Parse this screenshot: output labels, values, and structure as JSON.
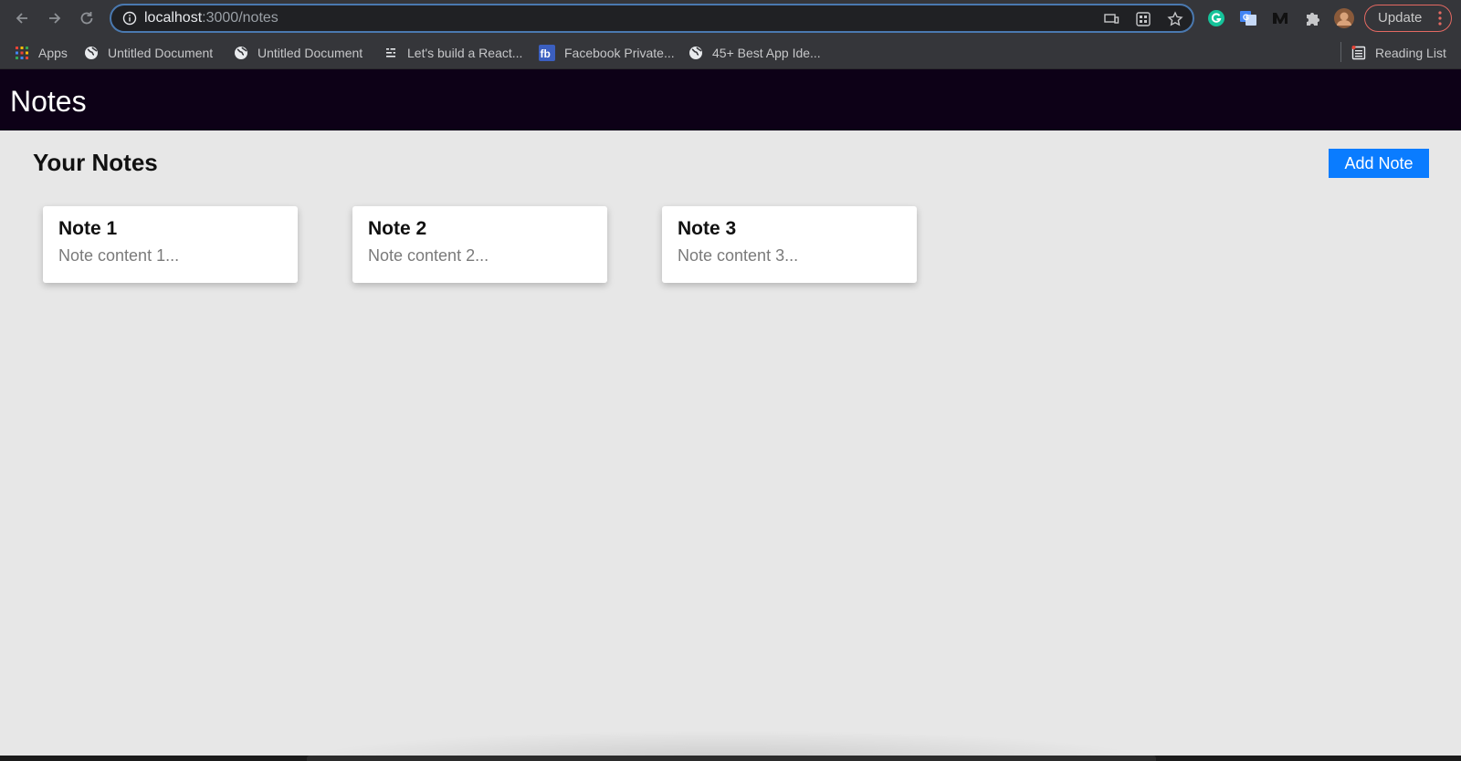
{
  "browser": {
    "url_host": "localhost",
    "url_path": ":3000/notes",
    "update_label": "Update",
    "bookmarks": [
      {
        "label": "Apps",
        "icon": "apps-grid-icon"
      },
      {
        "label": "Untitled Document",
        "icon": "globe-icon"
      },
      {
        "label": "Untitled Document",
        "icon": "globe-icon"
      },
      {
        "label": "Let's build a React...",
        "icon": "list-icon"
      },
      {
        "label": "Facebook Private...",
        "icon": "fb-icon"
      },
      {
        "label": "45+ Best App Ide...",
        "icon": "globe-icon"
      }
    ],
    "reading_list": "Reading List",
    "fb_glyph": "fb"
  },
  "app": {
    "title": "Notes",
    "heading": "Your Notes",
    "add_label": "Add Note",
    "notes": [
      {
        "title": "Note 1",
        "content": "Note content 1..."
      },
      {
        "title": "Note 2",
        "content": "Note content 2..."
      },
      {
        "title": "Note 3",
        "content": "Note content 3..."
      }
    ]
  },
  "colors": {
    "header_bg": "#0d0117",
    "page_bg": "#e7e7e7",
    "accent": "#0a7cff",
    "chrome_bg": "#35363a"
  }
}
